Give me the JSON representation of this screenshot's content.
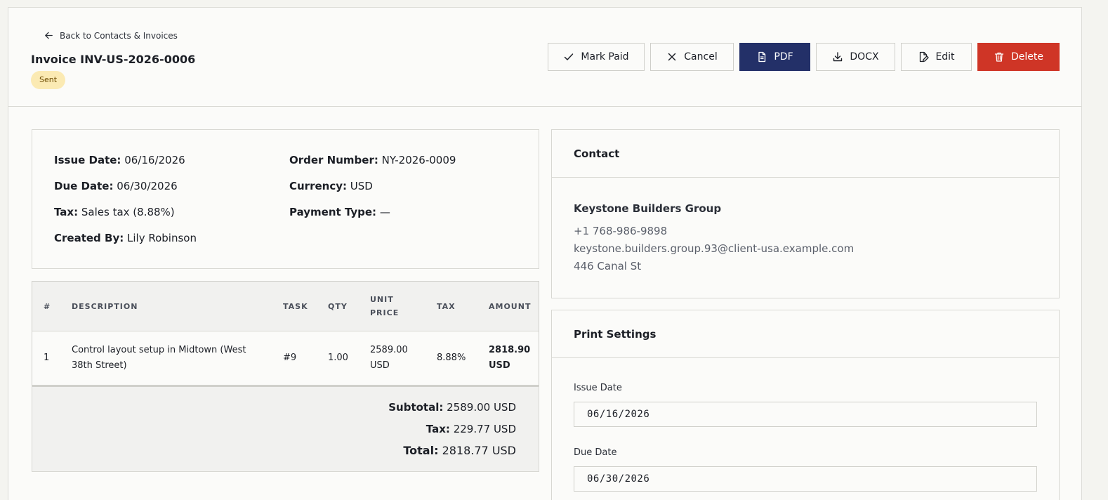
{
  "header": {
    "back_label": "Back to Contacts & Invoices",
    "title": "Invoice INV-US-2026-0006",
    "status": "Sent",
    "actions": {
      "mark_paid": "Mark Paid",
      "cancel": "Cancel",
      "pdf": "PDF",
      "docx": "DOCX",
      "edit": "Edit",
      "delete": "Delete"
    }
  },
  "details": {
    "issue_date_label": "Issue Date:",
    "issue_date": "06/16/2026",
    "due_date_label": "Due Date:",
    "due_date": "06/30/2026",
    "tax_label": "Tax:",
    "tax": "Sales tax (8.88%)",
    "created_by_label": "Created By:",
    "created_by": "Lily Robinson",
    "order_number_label": "Order Number:",
    "order_number": "NY-2026-0009",
    "currency_label": "Currency:",
    "currency": "USD",
    "payment_type_label": "Payment Type:",
    "payment_type": "—"
  },
  "items": {
    "headers": {
      "num": "#",
      "description": "DESCRIPTION",
      "task": "TASK",
      "qty": "QTY",
      "unit_price_1": "UNIT",
      "unit_price_2": "PRICE",
      "tax": "TAX",
      "amount": "AMOUNT"
    },
    "rows": [
      {
        "num": "1",
        "description_1": "Control layout setup in Midtown (West",
        "description_2": "38th Street)",
        "task": "#9",
        "qty": "1.00",
        "unit_price_1": "2589.00",
        "unit_price_2": "USD",
        "tax": "8.88%",
        "amount_1": "2818.90",
        "amount_2": "USD"
      }
    ]
  },
  "totals": {
    "subtotal_label": "Subtotal:",
    "subtotal": "2589.00 USD",
    "tax_label": "Tax:",
    "tax": "229.77 USD",
    "total_label": "Total:",
    "total": "2818.77 USD"
  },
  "contact": {
    "heading": "Contact",
    "name": "Keystone Builders Group",
    "phone": "+1 768-986-9898",
    "email": "keystone.builders.group.93@client-usa.example.com",
    "address": "446 Canal St"
  },
  "print_settings": {
    "heading": "Print Settings",
    "issue_date_label": "Issue Date",
    "issue_date_value": "06/16/2026",
    "due_date_label": "Due Date",
    "due_date_value": "06/30/2026"
  },
  "colors": {
    "primary": "#233068",
    "danger": "#cf3526",
    "badge_bg": "#fbeab3"
  },
  "icons": {
    "back": "arrow-left-icon",
    "mark_paid": "check-icon",
    "cancel": "x-icon",
    "pdf": "file-icon",
    "docx": "download-icon",
    "edit": "file-edit-icon",
    "delete": "trash-icon"
  }
}
